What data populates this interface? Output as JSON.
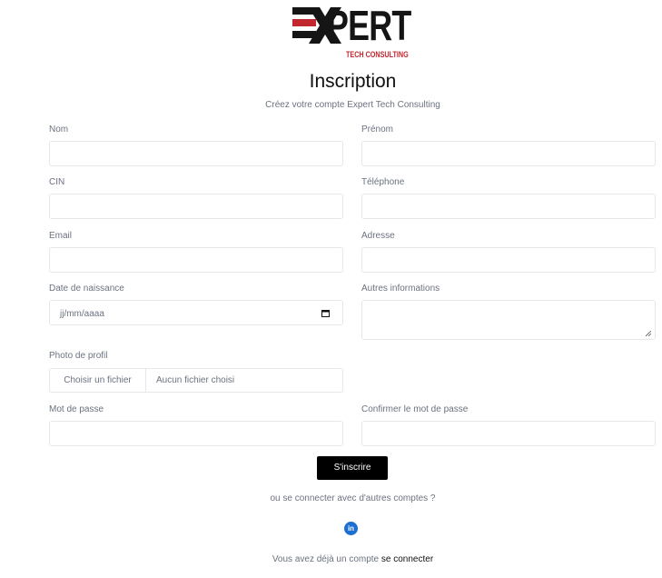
{
  "brand": {
    "logo_word": "PERT",
    "logo_subtitle": "TECH CONSULTING",
    "logo_text": "EXPERT TECH CONSULTING"
  },
  "page": {
    "title": "Inscription",
    "subtitle": "Créez votre compte Expert Tech Consulting"
  },
  "form": {
    "nom_label": "Nom",
    "prenom_label": "Prénom",
    "cin_label": "CIN",
    "telephone_label": "Téléphone",
    "email_label": "Email",
    "adresse_label": "Adresse",
    "dob_label": "Date de naissance",
    "dob_placeholder": "jj/mm/aaaa",
    "autres_label": "Autres informations",
    "photo_label": "Photo de profil",
    "file_button": "Choisir un fichier",
    "file_status": "Aucun fichier choisi",
    "password_label": "Mot de passe",
    "confirm_label": "Confirmer le mot de passe",
    "submit_label": "S'inscrire"
  },
  "social": {
    "prompt": "ou se connecter avec d'autres comptes ?",
    "linkedin_icon_text": "in"
  },
  "footer": {
    "prompt": "Vous avez déjà un compte",
    "link": "se connecter"
  },
  "colors": {
    "brand_red": "#c1272d",
    "linkedin": "#1d6fd1",
    "button": "#000000"
  }
}
